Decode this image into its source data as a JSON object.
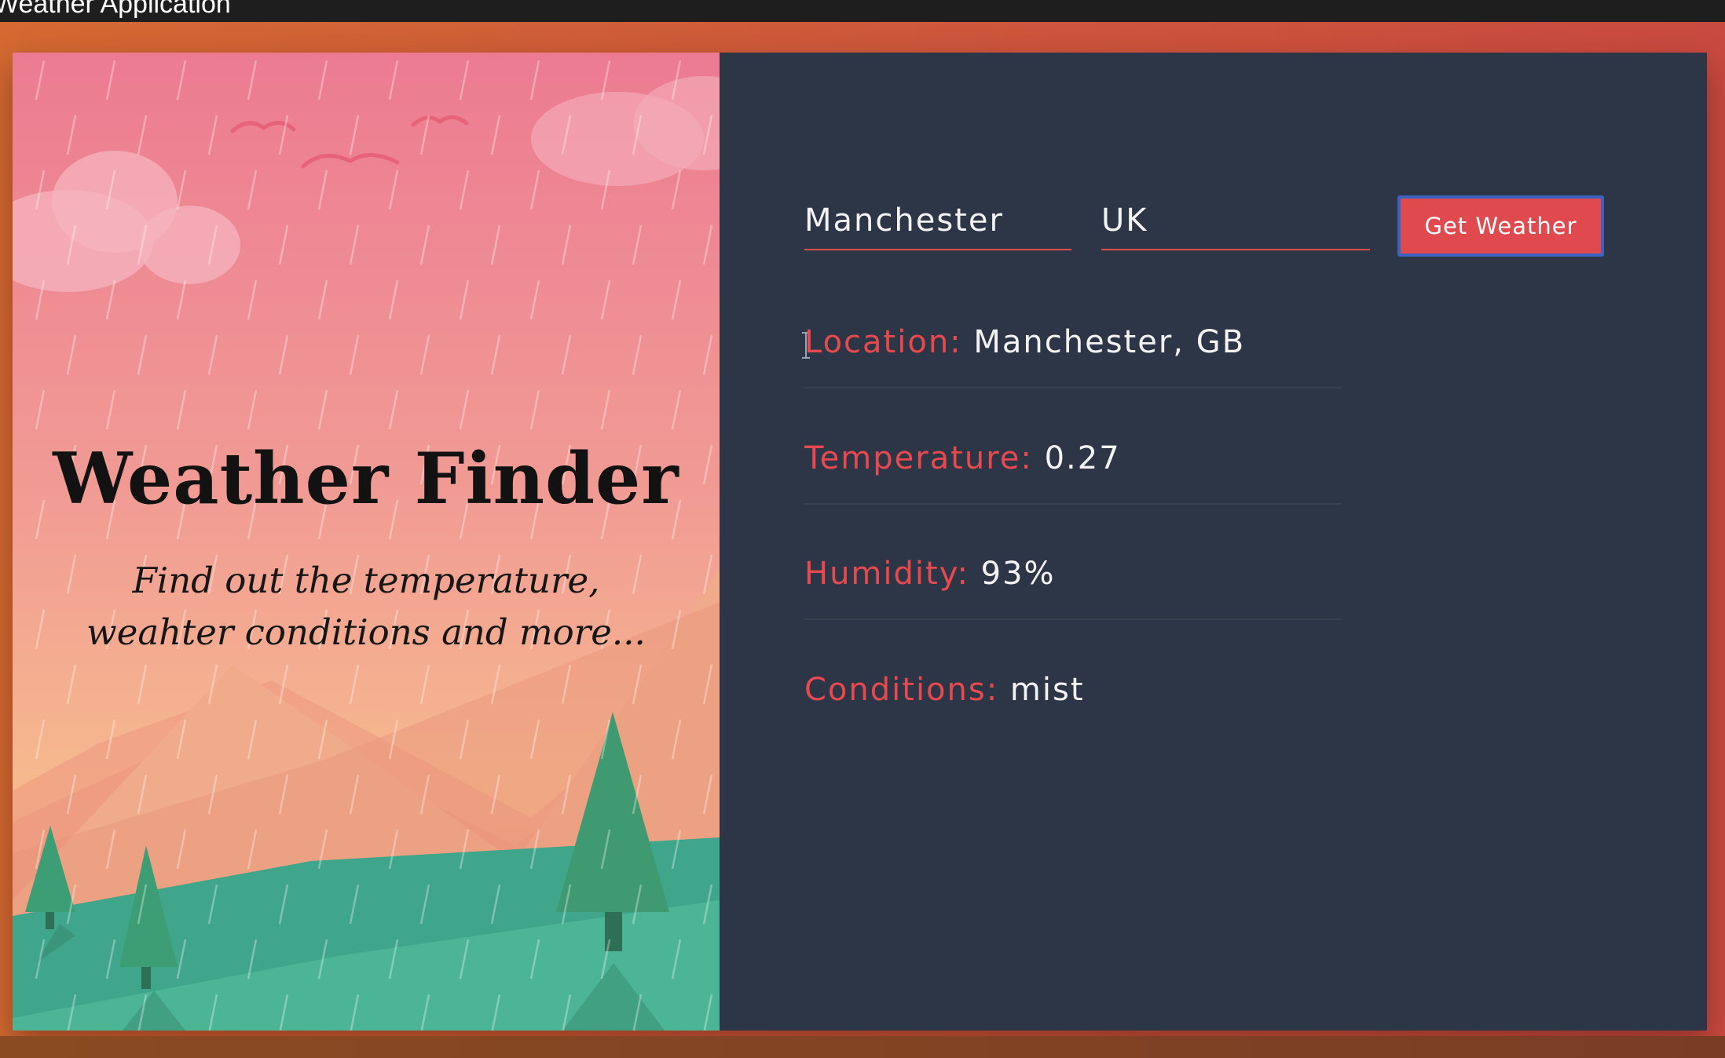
{
  "window": {
    "title": "Weather Application"
  },
  "hero": {
    "title": "Weather Finder",
    "subtitle": "Find out the temperature, weahter conditions and more..."
  },
  "form": {
    "city_value": "Manchester",
    "country_value": "UK",
    "submit_label": "Get Weather"
  },
  "results": {
    "location": {
      "label": "Location:",
      "value": "Manchester, GB"
    },
    "temperature": {
      "label": "Temperature:",
      "value": "0.27"
    },
    "humidity": {
      "label": "Humidity:",
      "value": "93%"
    },
    "conditions": {
      "label": "Conditions:",
      "value": "mist"
    }
  },
  "colors": {
    "accent": "#e0494e",
    "panel": "#2c3646",
    "button_focus_border": "#3d63c2",
    "tree_green": "#3f9a72"
  }
}
